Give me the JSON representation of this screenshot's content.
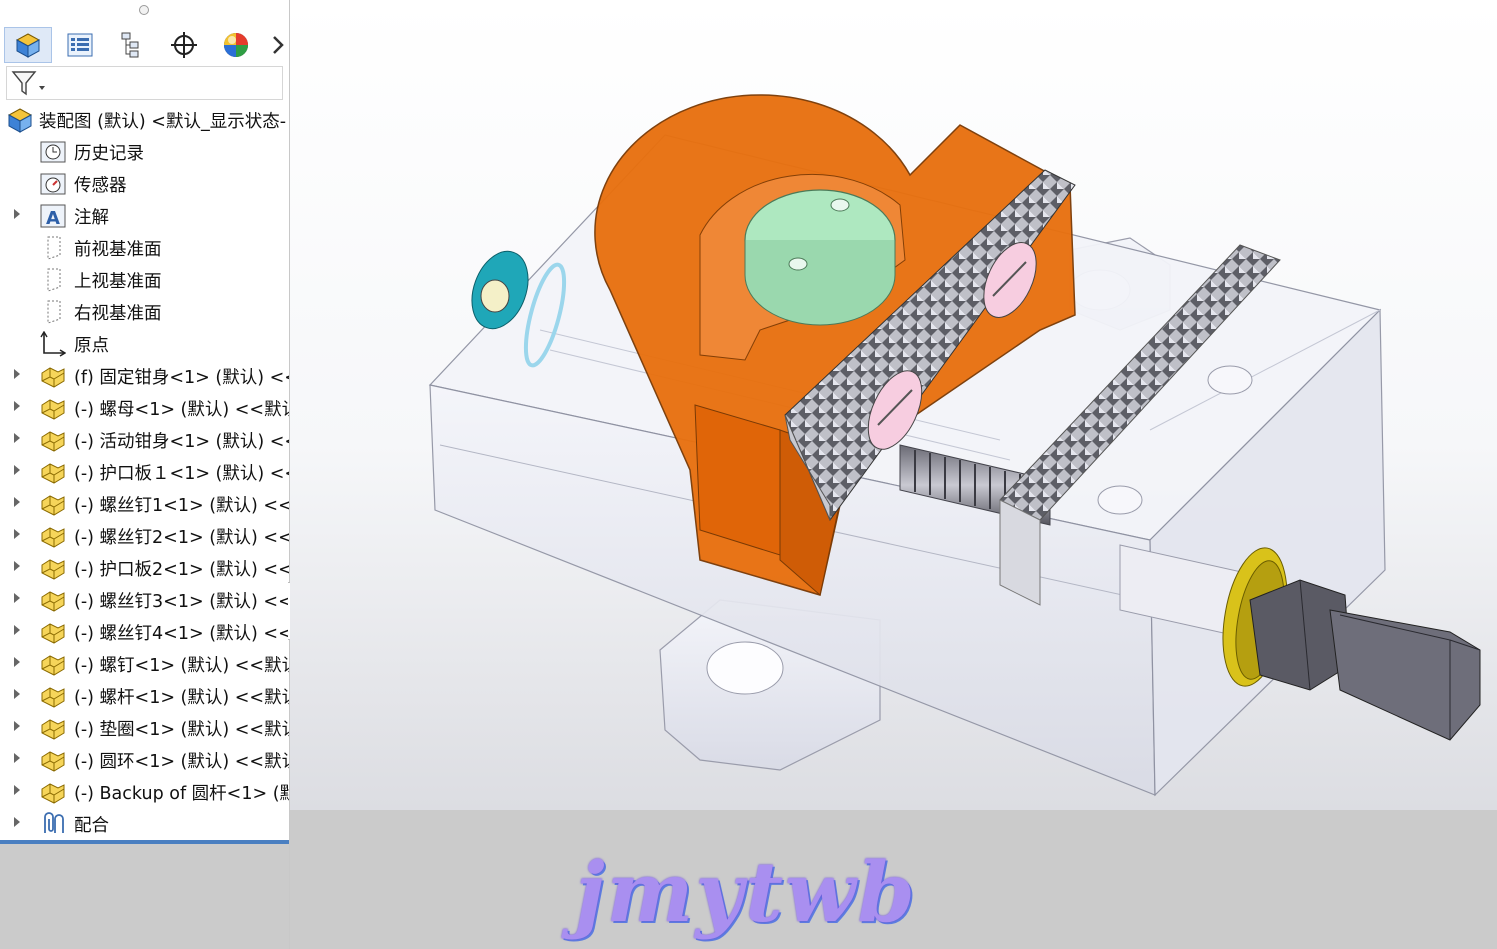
{
  "feature_manager": {
    "tabs": [
      {
        "icon": "feature-manager-tab-icon",
        "active": true
      },
      {
        "icon": "property-manager-tab-icon"
      },
      {
        "icon": "configuration-manager-tab-icon"
      },
      {
        "icon": "dimxpert-manager-tab-icon"
      },
      {
        "icon": "display-manager-tab-icon"
      }
    ],
    "more_icon": "chevron-right-icon",
    "filter_icon": "filter-icon",
    "tree": {
      "root": {
        "label": "装配图 (默认) <默认_显示状态-",
        "icon": "assembly-icon"
      },
      "items": [
        {
          "label": "历史记录",
          "icon": "history-icon",
          "expandable": false
        },
        {
          "label": "传感器",
          "icon": "sensor-icon",
          "expandable": false
        },
        {
          "label": "注解",
          "icon": "annotation-icon",
          "expandable": true
        },
        {
          "label": "前视基准面",
          "icon": "plane-icon",
          "expandable": false
        },
        {
          "label": "上视基准面",
          "icon": "plane-icon",
          "expandable": false
        },
        {
          "label": "右视基准面",
          "icon": "plane-icon",
          "expandable": false
        },
        {
          "label": "原点",
          "icon": "origin-icon",
          "expandable": false
        },
        {
          "label": "(f) 固定钳身<1> (默认) <<",
          "icon": "part-icon",
          "expandable": true
        },
        {
          "label": "(-) 螺母<1> (默认) <<默认",
          "icon": "part-icon",
          "expandable": true
        },
        {
          "label": "(-) 活动钳身<1> (默认) <<",
          "icon": "part-icon",
          "expandable": true
        },
        {
          "label": "(-) 护口板１<1> (默认) <<",
          "icon": "part-icon",
          "expandable": true
        },
        {
          "label": "(-) 螺丝钉1<1> (默认) <<!",
          "icon": "part-icon",
          "expandable": true
        },
        {
          "label": "(-) 螺丝钉2<1> (默认) <<!",
          "icon": "part-icon",
          "expandable": true
        },
        {
          "label": "(-) 护口板2<1> (默认) <<!",
          "icon": "part-icon",
          "expandable": true
        },
        {
          "label": "(-) 螺丝钉3<1> (默认) <<!",
          "icon": "part-icon",
          "expandable": true
        },
        {
          "label": "(-) 螺丝钉4<1> (默认) <<!",
          "icon": "part-icon",
          "expandable": true
        },
        {
          "label": "(-) 螺钉<1> (默认) <<默认",
          "icon": "part-icon",
          "expandable": true
        },
        {
          "label": "(-) 螺杆<1> (默认) <<默认",
          "icon": "part-icon",
          "expandable": true
        },
        {
          "label": "(-) 垫圈<1> (默认) <<默认",
          "icon": "part-icon",
          "expandable": true
        },
        {
          "label": "(-) 圆环<1> (默认) <<默认",
          "icon": "part-icon",
          "expandable": true
        },
        {
          "label": "(-) Backup of 圆杆<1> (默",
          "icon": "part-icon",
          "expandable": true
        },
        {
          "label": "配合",
          "icon": "mates-icon",
          "expandable": true
        }
      ]
    }
  },
  "viewport": {
    "model_colors": {
      "body": "#e9ebf3",
      "movable_jaw": "#e8700f",
      "nut_top": "#aee8c0",
      "screw": "#8c8c98",
      "washer": "#d9c21a",
      "ring": "#1fa7b8",
      "jaw_plate_face": "#f7cde0"
    }
  },
  "watermark": {
    "text": "jmytwb"
  }
}
